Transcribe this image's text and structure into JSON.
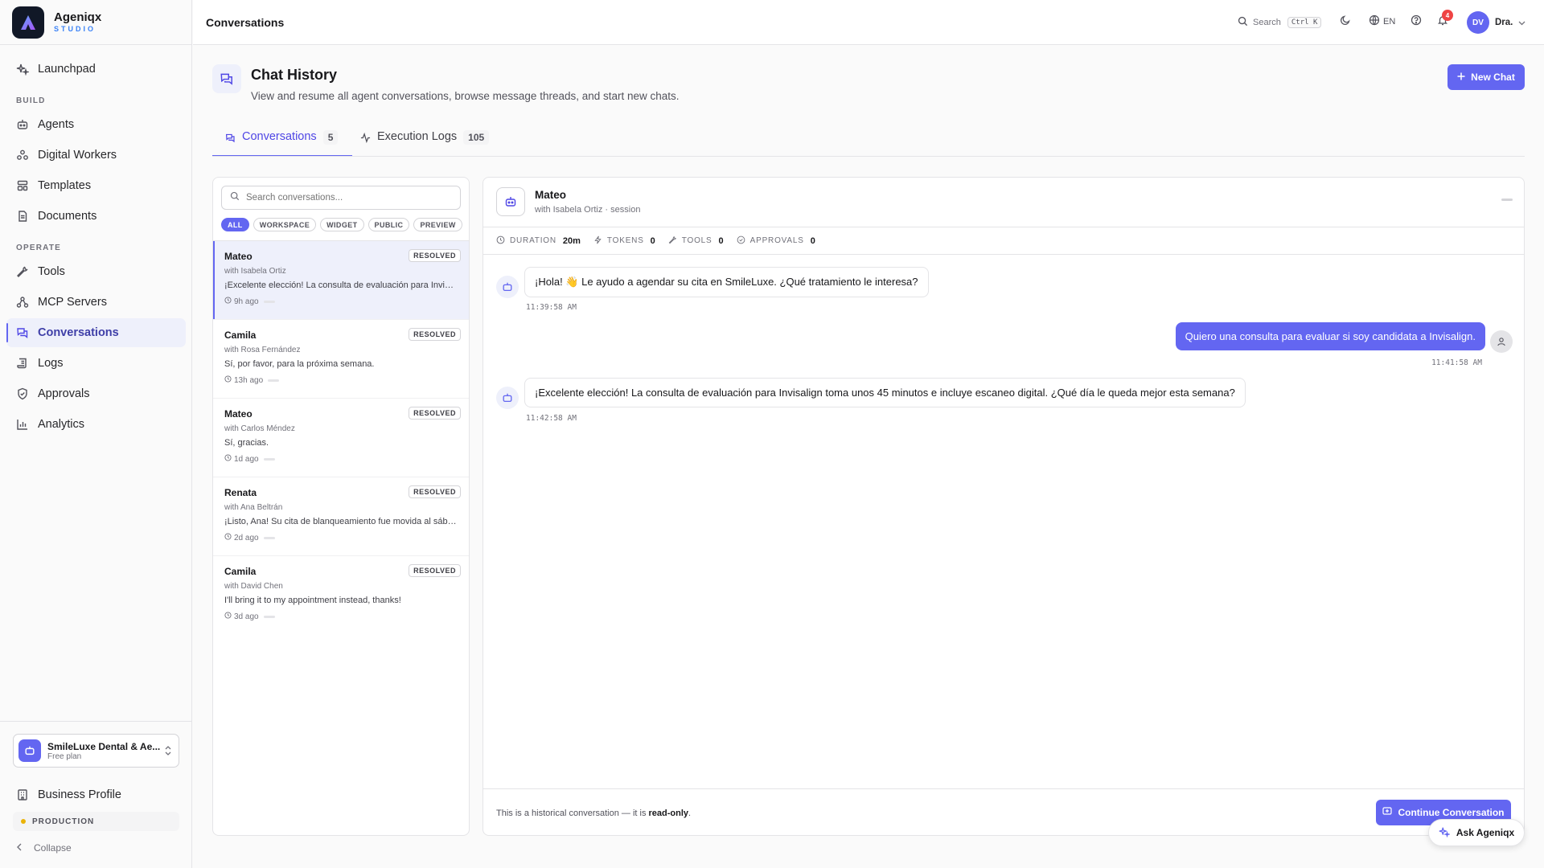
{
  "brand": {
    "name": "Ageniqx",
    "subtitle": "STUDIO"
  },
  "sidebar": {
    "launchpad": "Launchpad",
    "build_label": "BUILD",
    "build_items": [
      "Agents",
      "Digital Workers",
      "Templates",
      "Documents"
    ],
    "operate_label": "OPERATE",
    "operate_items": [
      "Tools",
      "MCP Servers",
      "Conversations",
      "Logs",
      "Approvals",
      "Analytics"
    ],
    "active_item": "Conversations",
    "org": {
      "name": "SmileLuxe Dental & Ae...",
      "plan": "Free plan"
    },
    "business_profile": "Business Profile",
    "environment": "PRODUCTION",
    "collapse": "Collapse"
  },
  "header": {
    "title": "Conversations",
    "search_label": "Search",
    "search_shortcut": "Ctrl K",
    "language": "EN",
    "notifications_count": "4",
    "user_initials": "DV",
    "user_name": "Dra."
  },
  "page": {
    "title": "Chat History",
    "subtitle": "View and resume all agent conversations, browse message threads, and start new chats.",
    "new_chat_label": "New Chat",
    "tabs": [
      {
        "label": "Conversations",
        "count": "5"
      },
      {
        "label": "Execution Logs",
        "count": "105"
      }
    ]
  },
  "conversation_list": {
    "search_placeholder": "Search conversations...",
    "filters": [
      "ALL",
      "WORKSPACE",
      "WIDGET",
      "PUBLIC",
      "PREVIEW"
    ],
    "active_filter": "ALL",
    "items": [
      {
        "agent": "Mateo",
        "with": "with Isabela Ortiz",
        "status": "RESOLVED",
        "preview": "¡Excelente elección! La consulta de evaluación para Invisalign toma unos 45 minutos e incluye escaneo digital.",
        "time": "9h ago"
      },
      {
        "agent": "Camila",
        "with": "with Rosa Fernández",
        "status": "RESOLVED",
        "preview": "Sí, por favor, para la próxima semana.",
        "time": "13h ago"
      },
      {
        "agent": "Mateo",
        "with": "with Carlos Méndez",
        "status": "RESOLVED",
        "preview": "Sí, gracias.",
        "time": "1d ago"
      },
      {
        "agent": "Renata",
        "with": "with Ana Beltrán",
        "status": "RESOLVED",
        "preview": "¡Listo, Ana! Su cita de blanqueamiento fue movida al sábado.",
        "time": "2d ago"
      },
      {
        "agent": "Camila",
        "with": "with David Chen",
        "status": "RESOLVED",
        "preview": "I'll bring it to my appointment instead, thanks!",
        "time": "3d ago"
      }
    ]
  },
  "chat": {
    "agent_name": "Mateo",
    "with_line": "with Isabela Ortiz · session",
    "stats": [
      {
        "label": "DURATION",
        "value": "20m"
      },
      {
        "label": "TOKENS",
        "value": "0"
      },
      {
        "label": "TOOLS",
        "value": "0"
      },
      {
        "label": "APPROVALS",
        "value": "0"
      }
    ],
    "messages": [
      {
        "role": "assistant",
        "text": "¡Hola! 👋 Le ayudo a agendar su cita en SmileLuxe. ¿Qué tratamiento le interesa?",
        "time": "11:39:58 AM"
      },
      {
        "role": "user",
        "text": "Quiero una consulta para evaluar si soy candidata a Invisalign.",
        "time": "11:41:58 AM"
      },
      {
        "role": "assistant",
        "text": "¡Excelente elección! La consulta de evaluación para Invisalign toma unos 45 minutos e incluye escaneo digital. ¿Qué día le queda mejor esta semana?",
        "time": "11:42:58 AM"
      }
    ],
    "footer_note_prefix": "This is a historical conversation — it is ",
    "footer_note_strong": "read-only",
    "footer_note_suffix": ".",
    "continue_label": "Continue Conversation"
  },
  "assistant_button": "Ask Ageniqx",
  "colors": {
    "accent": "#6366f1",
    "accent_bg": "#eef0fb",
    "notification": "#ef4444",
    "env_dot": "#eab308"
  }
}
